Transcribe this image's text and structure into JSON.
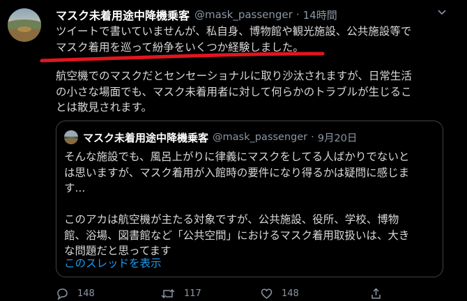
{
  "tweet": {
    "author_name": "マスク未着用途中降機乗客",
    "author_handle": "@mask_passenger",
    "time": "14時間",
    "paragraph1_line1": "ツイートで書いていませんが、私自身、博物館や観光施設、公共施設等で",
    "paragraph1_line2": "マスク着用を巡って紛争をいくつか経験しました。",
    "paragraph2_line1": "航空機でのマスクだとセンセーショナルに取り沙汰されますが、日常生活",
    "paragraph2_line2": "の小さな場面でも、マスク未着用者に対して何らかのトラブルが生じるこ",
    "paragraph2_line3": "とは散見されます。"
  },
  "quote": {
    "author_name": "マスク未着用途中降機乗客",
    "author_handle": "@mask_passenger",
    "date": "9月20日",
    "line1": "そんな施設でも、風呂上がりに律義にマスクをしてる人ばかりでないと",
    "line2": "は思いますが、マスク着用が入館時の要件になり得るかは疑問に感じま",
    "line3": "す...",
    "line4": "このアカは航空機が主たる対象ですが、公共施設、役所、学校、博物",
    "line5": "館、浴場、図書館など「公共空間」におけるマスク着用取扱いは、大き",
    "line6": "な問題だと思ってます",
    "show_thread": "このスレッドを表示"
  },
  "actions": {
    "reply_count": "148",
    "retweet_count": "117",
    "like_count": "148"
  },
  "icons": {
    "more": "more-icon",
    "reply": "reply-icon",
    "retweet": "retweet-icon",
    "like": "like-icon",
    "share": "share-icon"
  },
  "colors": {
    "background": "#000000",
    "text": "#d9d9d9",
    "secondary": "#8b98a5",
    "link": "#1d9bf0",
    "annotation": "#e1161e"
  }
}
